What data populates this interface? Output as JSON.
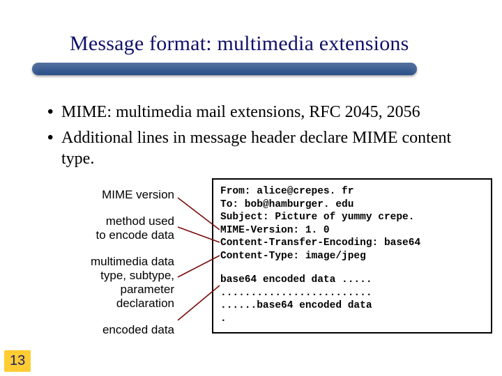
{
  "title": "Message format: multimedia extensions",
  "bullets": [
    "MIME: multimedia mail extensions, RFC 2045, 2056",
    "Additional lines in message header declare MIME content type."
  ],
  "annotations": {
    "a1": "MIME version",
    "a2": "method used\nto encode data",
    "a3": "multimedia data\ntype, subtype,\nparameter\ndeclaration",
    "a4": "encoded data"
  },
  "code": {
    "from": "From: alice@crepes. fr",
    "to": "To: bob@hamburger. edu",
    "subject": "Subject: Picture of yummy crepe.",
    "mimever": "MIME-Version: 1. 0",
    "cte": "Content-Transfer-Encoding: base64",
    "ctype": "Content-Type: image/jpeg",
    "body1": "base64 encoded data .....",
    "body2": ".........................",
    "body3": "......base64 encoded data",
    "body4": "."
  },
  "page_number": "13"
}
